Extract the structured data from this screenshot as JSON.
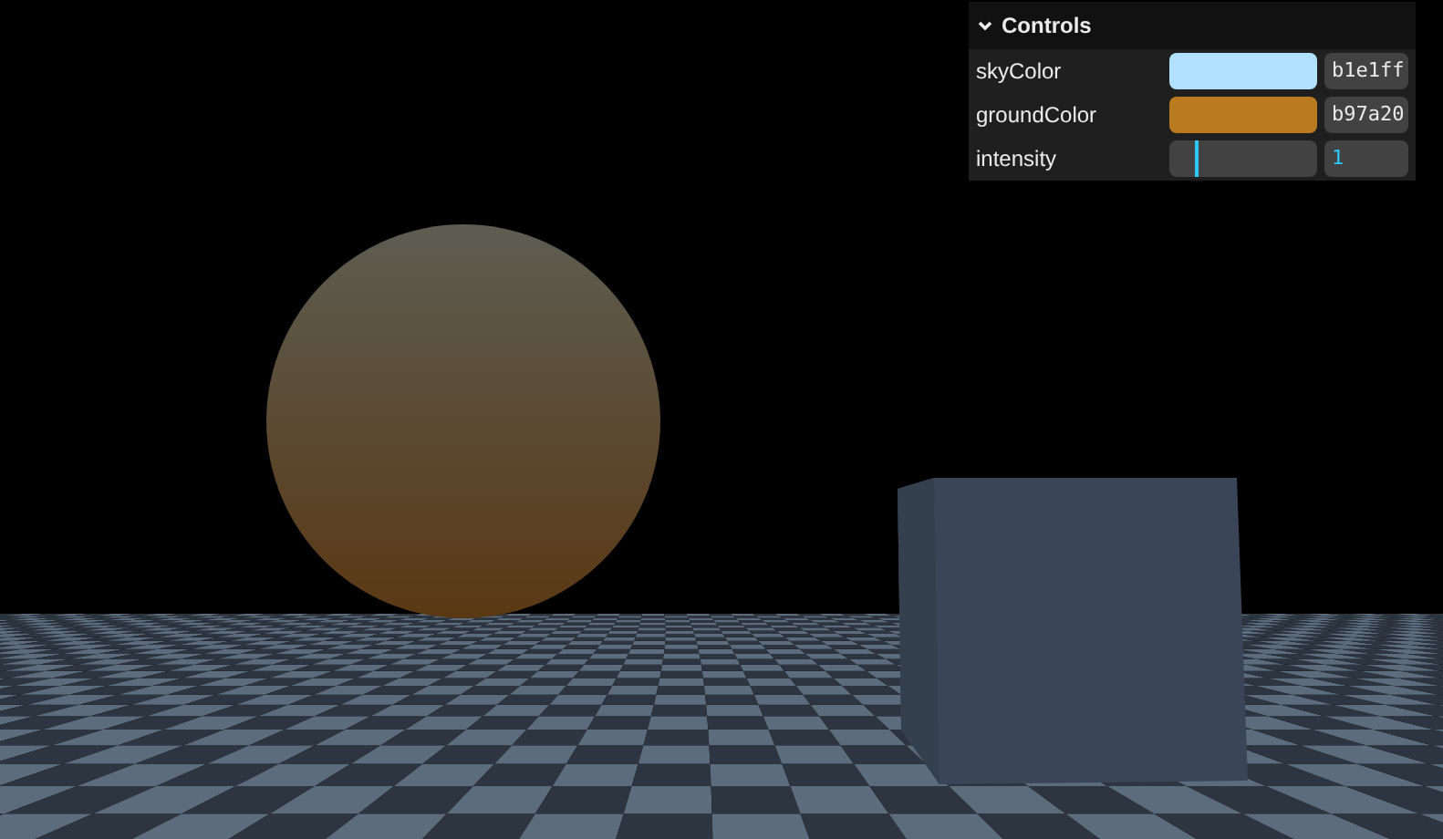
{
  "gui": {
    "title": "Controls",
    "expanded": true,
    "controls": [
      {
        "kind": "color",
        "label": "skyColor",
        "color": "#b1e1ff",
        "value": "b1e1ff"
      },
      {
        "kind": "color",
        "label": "groundColor",
        "color": "#b97a20",
        "value": "b97a20"
      },
      {
        "kind": "slider",
        "label": "intensity",
        "level": 0.2,
        "value": "1"
      }
    ]
  }
}
